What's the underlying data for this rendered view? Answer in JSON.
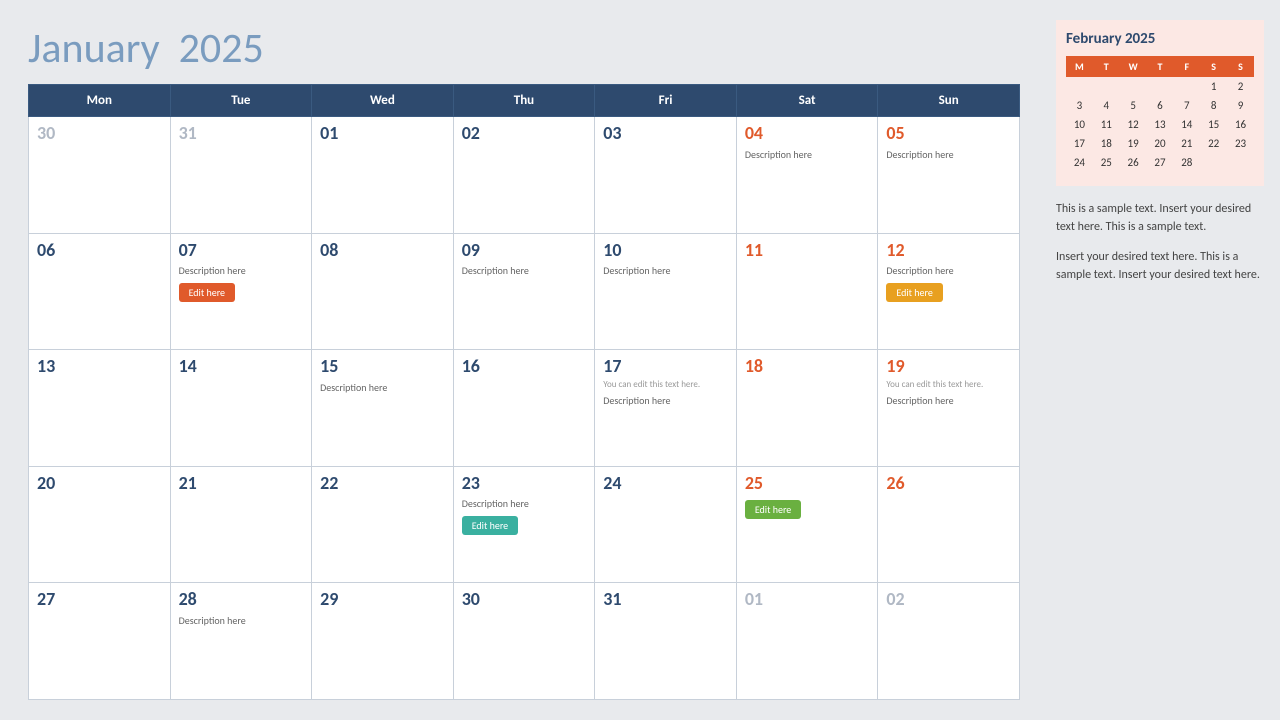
{
  "header": {
    "month": "January",
    "year": "2025"
  },
  "weekdays": [
    "Mon",
    "Tue",
    "Wed",
    "Thu",
    "Fri",
    "Sat",
    "Sun"
  ],
  "rows": [
    [
      {
        "num": "30",
        "type": "other-month"
      },
      {
        "num": "31",
        "type": "other-month"
      },
      {
        "num": "01",
        "type": "normal"
      },
      {
        "num": "02",
        "type": "normal"
      },
      {
        "num": "03",
        "type": "normal"
      },
      {
        "num": "04",
        "type": "weekend",
        "desc": "Description here"
      },
      {
        "num": "05",
        "type": "weekend",
        "desc": "Description here"
      }
    ],
    [
      {
        "num": "06",
        "type": "normal"
      },
      {
        "num": "07",
        "type": "normal",
        "desc": "Description here",
        "btn": "Edit here",
        "btnColor": "red"
      },
      {
        "num": "08",
        "type": "normal"
      },
      {
        "num": "09",
        "type": "normal",
        "desc": "Description here"
      },
      {
        "num": "10",
        "type": "normal",
        "desc": "Description here"
      },
      {
        "num": "11",
        "type": "weekend"
      },
      {
        "num": "12",
        "type": "weekend",
        "desc": "Description here",
        "btn": "Edit here",
        "btnColor": "orange"
      }
    ],
    [
      {
        "num": "13",
        "type": "normal"
      },
      {
        "num": "14",
        "type": "normal"
      },
      {
        "num": "15",
        "type": "normal",
        "desc": "Description here"
      },
      {
        "num": "16",
        "type": "normal"
      },
      {
        "num": "17",
        "type": "normal",
        "note": "You can edit this text here.",
        "desc": "Description here"
      },
      {
        "num": "18",
        "type": "weekend"
      },
      {
        "num": "19",
        "type": "weekend",
        "note": "You can edit this text here.",
        "desc": "Description here"
      }
    ],
    [
      {
        "num": "20",
        "type": "normal"
      },
      {
        "num": "21",
        "type": "normal"
      },
      {
        "num": "22",
        "type": "normal"
      },
      {
        "num": "23",
        "type": "normal",
        "desc": "Description here",
        "btn": "Edit here",
        "btnColor": "teal"
      },
      {
        "num": "24",
        "type": "normal"
      },
      {
        "num": "25",
        "type": "weekend",
        "btn": "Edit here",
        "btnColor": "green"
      },
      {
        "num": "26",
        "type": "weekend"
      }
    ],
    [
      {
        "num": "27",
        "type": "normal"
      },
      {
        "num": "28",
        "type": "normal",
        "desc": "Description here"
      },
      {
        "num": "29",
        "type": "normal"
      },
      {
        "num": "30",
        "type": "normal"
      },
      {
        "num": "31",
        "type": "normal"
      },
      {
        "num": "01",
        "type": "other-month"
      },
      {
        "num": "02",
        "type": "other-month"
      }
    ]
  ],
  "sidebar": {
    "mini_title": "February 2025",
    "mini_headers": [
      "M",
      "T",
      "W",
      "T",
      "F",
      "S",
      "S"
    ],
    "mini_rows": [
      [
        "",
        "",
        "",
        "",
        "",
        "1",
        "2"
      ],
      [
        "3",
        "4",
        "5",
        "6",
        "7",
        "8",
        "9"
      ],
      [
        "10",
        "11",
        "12",
        "13",
        "14",
        "15",
        "16"
      ],
      [
        "17",
        "18",
        "19",
        "20",
        "21",
        "22",
        "23"
      ],
      [
        "24",
        "25",
        "26",
        "27",
        "28",
        "",
        ""
      ]
    ],
    "text1": "This is a sample text. Insert your desired text here. This is a sample text.",
    "text2": "Insert your desired text here. This is a sample text. Insert your desired text here."
  }
}
